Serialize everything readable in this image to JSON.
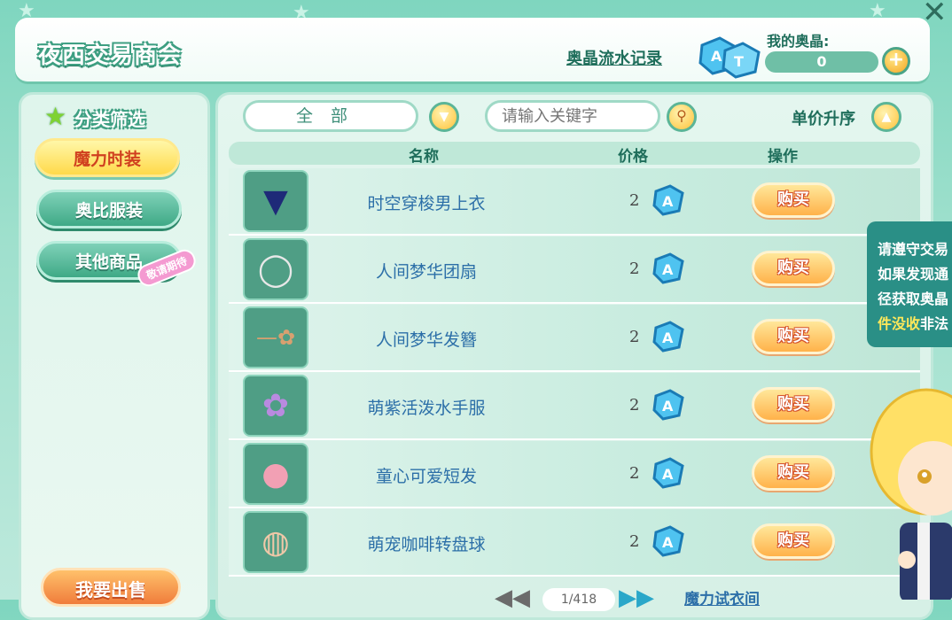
{
  "header": {
    "title": "夜西交易商会",
    "record_link": "奥晶流水记录",
    "my_crystal_label": "我的奥晶:",
    "balance": "0",
    "plus_symbol": "+"
  },
  "sidebar": {
    "title": "分类筛选",
    "categories": [
      {
        "label": "魔力时装",
        "active": true
      },
      {
        "label": "奥比服装",
        "active": false
      },
      {
        "label": "其他商品",
        "active": false
      }
    ],
    "coming_soon_badge": "敬请期待",
    "sell_button": "我要出售"
  },
  "toolbar": {
    "filter_value": "全部",
    "search_placeholder": "请输入关键字",
    "sort_label": "单价升序"
  },
  "table": {
    "columns": [
      "名称",
      "价格",
      "操作"
    ],
    "buy_label": "购买",
    "rows": [
      {
        "name": "时空穿梭男上衣",
        "price": "2",
        "icon": "jacket-icon"
      },
      {
        "name": "人间梦华团扇",
        "price": "2",
        "icon": "fan-icon"
      },
      {
        "name": "人间梦华发簪",
        "price": "2",
        "icon": "hairpin-icon"
      },
      {
        "name": "萌紫活泼水手服",
        "price": "2",
        "icon": "sailor-dress-icon"
      },
      {
        "name": "童心可爱短发",
        "price": "2",
        "icon": "short-hair-icon"
      },
      {
        "name": "萌宠咖啡转盘球",
        "price": "2",
        "icon": "pet-toy-icon"
      }
    ]
  },
  "notice": {
    "lines": [
      "请遵守交易",
      "如果发现通",
      "径获取奥晶"
    ],
    "highlight": "件没收",
    "tail": "非法"
  },
  "pagination": {
    "page_text": "1/418",
    "try_on_link": "魔力试衣间"
  },
  "colors": {
    "accent": "#3e9f82",
    "buy_button": "#ffb24a",
    "active_category": "#ffd94a"
  }
}
